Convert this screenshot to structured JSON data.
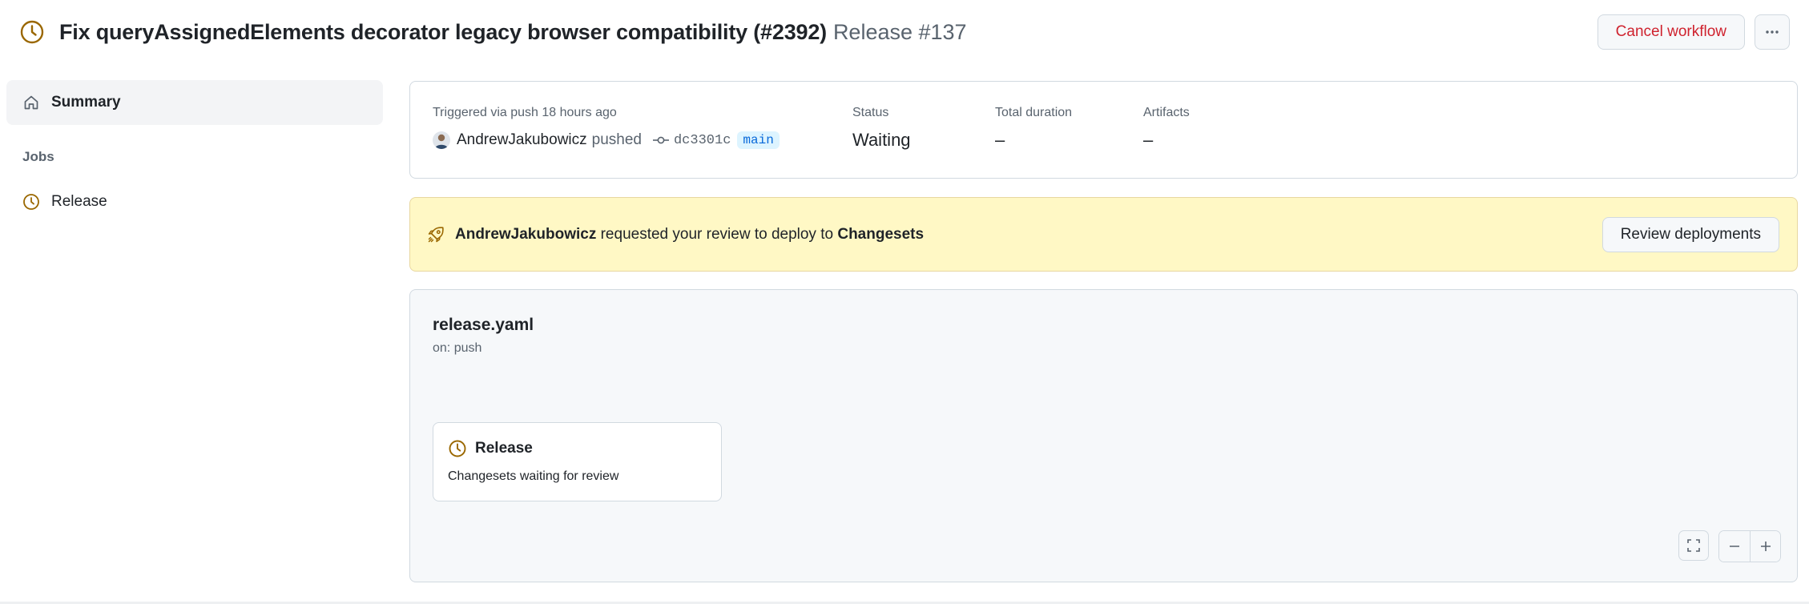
{
  "header": {
    "title": "Fix queryAssignedElements decorator legacy browser compatibility (#2392)",
    "run_label": "Release #137",
    "status_icon": "clock-icon",
    "cancel_label": "Cancel workflow",
    "more_icon": "kebab-horizontal-icon"
  },
  "sidebar": {
    "summary_label": "Summary",
    "jobs_heading": "Jobs",
    "jobs": [
      {
        "label": "Release",
        "icon": "clock-icon"
      }
    ]
  },
  "summary": {
    "triggered": "Triggered via push 18 hours ago",
    "actor": "AndrewJakubowicz",
    "action": "pushed",
    "commit": "dc3301c",
    "branch": "main",
    "status_label": "Status",
    "status_value": "Waiting",
    "duration_label": "Total duration",
    "duration_value": "–",
    "artifacts_label": "Artifacts",
    "artifacts_value": "–"
  },
  "deploy": {
    "actor": "AndrewJakubowicz",
    "text": " requested your review to deploy to ",
    "environment": "Changesets",
    "button": "Review deployments",
    "icon": "rocket-icon",
    "colors": {
      "background": "#fff8c5",
      "border": "#e8d7a0"
    }
  },
  "graph": {
    "file": "release.yaml",
    "trigger": "on: push",
    "job": {
      "title": "Release",
      "description": "Changesets waiting for review"
    }
  },
  "colors": {
    "waiting": "#9a6700",
    "danger": "#cf222e",
    "link": "#0969da"
  }
}
